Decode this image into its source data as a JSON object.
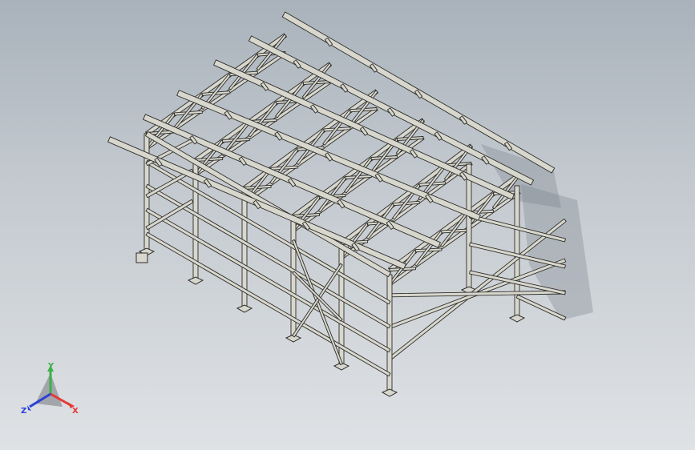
{
  "viewport": {
    "background_top": "#a9b2bb",
    "background_bottom": "#dfe2e5",
    "model_color": "#d8d7cd",
    "edge_color": "#2d2d2a"
  },
  "triad": {
    "x_label": "X",
    "y_label": "Y",
    "z_label": "Z",
    "x_color": "#e53935",
    "y_color": "#3cb04a",
    "z_color": "#2b3fd6"
  }
}
